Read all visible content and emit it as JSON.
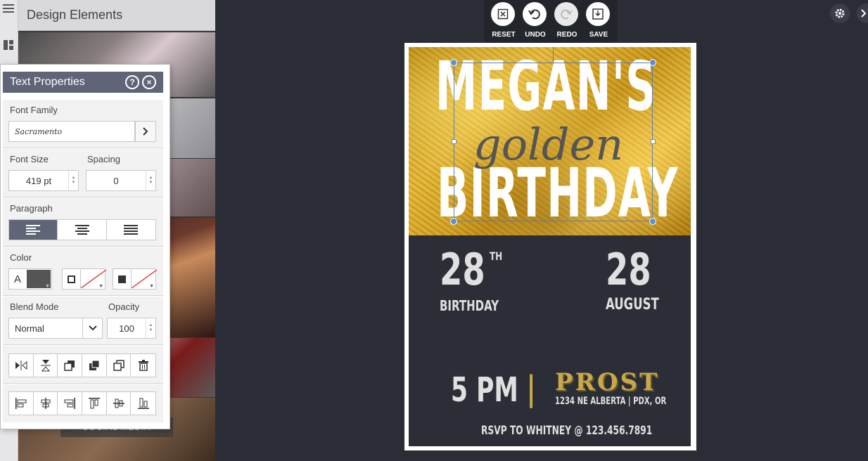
{
  "design_panel": {
    "title": "Design Elements",
    "bottom_label": "SOCIAL MEDIA"
  },
  "text_properties": {
    "title": "Text Properties",
    "help": "?",
    "close": "×",
    "font_family_label": "Font Family",
    "font_family_value": "Sacramento",
    "font_size_label": "Font Size",
    "font_size_value": "419 pt",
    "spacing_label": "Spacing",
    "spacing_value": "0",
    "paragraph_label": "Paragraph",
    "color_label": "Color",
    "color_text_glyph": "A",
    "blend_mode_label": "Blend Mode",
    "blend_mode_value": "Normal",
    "opacity_label": "Opacity",
    "opacity_value": "100",
    "text_color": "#555555"
  },
  "toolbar": {
    "reset": "RESET",
    "undo": "UNDO",
    "redo": "REDO",
    "save": "SAVE"
  },
  "card": {
    "line1": "MEGAN'S",
    "line2": "golden",
    "line3": "BIRTHDAY",
    "day_num": "28",
    "day_sup": "TH",
    "day_label": "BIRTHDAY",
    "month_num": "28",
    "month_label": "AUGUST",
    "time": "5 PM",
    "divider": "|",
    "venue": "PROST",
    "address": "1234 NE ALBERTA  |  PDX, OR",
    "rsvp": "RSVP TO WHITNEY @ 123.456.7891",
    "gold_color": "#c9a84c",
    "dark_bg": "#2c2e37"
  }
}
